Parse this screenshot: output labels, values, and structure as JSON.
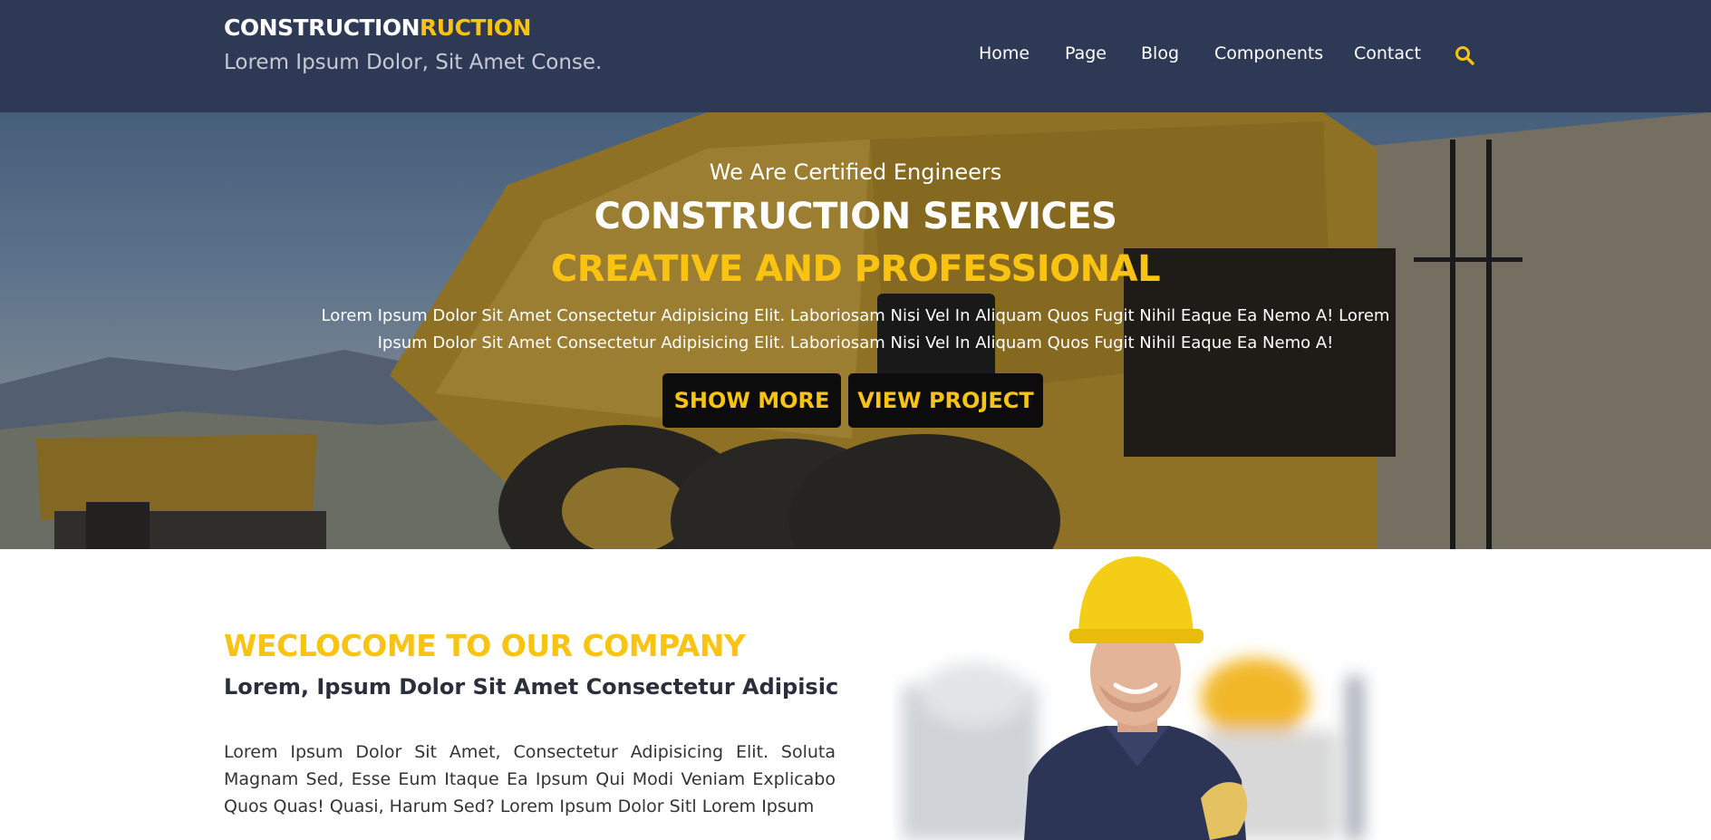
{
  "header": {
    "logo_main": "CONSTRUCTION",
    "logo_accent": "RUCTION",
    "tagline": "Lorem Ipsum Dolor, Sit Amet Conse.",
    "nav": [
      "Home",
      "Page",
      "Blog",
      "Components",
      "Contact"
    ],
    "search_icon": "search-icon"
  },
  "hero": {
    "kicker": "We Are Certified Engineers",
    "title": "CONSTRUCTION SERVICES",
    "subtitle": "CREATIVE AND PROFESSIONAL",
    "body_line1": "Lorem Ipsum Dolor Sit Amet Consectetur Adipisicing Elit. Laboriosam Nisi Vel In Aliquam Quos Fugit Nihil Eaque Ea Nemo A! Lorem",
    "body_line2": "Ipsum Dolor Sit Amet Consectetur Adipisicing Elit. Laboriosam Nisi Vel In Aliquam Quos Fugit Nihil Eaque Ea Nemo A!",
    "buttons": [
      "SHOW MORE",
      "VIEW PROJECT"
    ]
  },
  "about": {
    "heading": "WECLOCOME TO OUR COMPANY",
    "subheading": "Lorem, Ipsum Dolor Sit Amet Consectetur Adipisic",
    "body": "Lorem Ipsum Dolor Sit Amet, Consectetur Adipisicing Elit. Soluta Magnam Sed, Esse Eum Itaque Ea Ipsum Qui Modi Veniam Explicabo Quos Quas! Quasi, Harum Sed? Lorem Ipsum Dolor Sitl Lorem Ipsum"
  },
  "colors": {
    "header_bg": "#2e3a55",
    "accent": "#f9c311",
    "button_bg": "#0c0c0c"
  }
}
